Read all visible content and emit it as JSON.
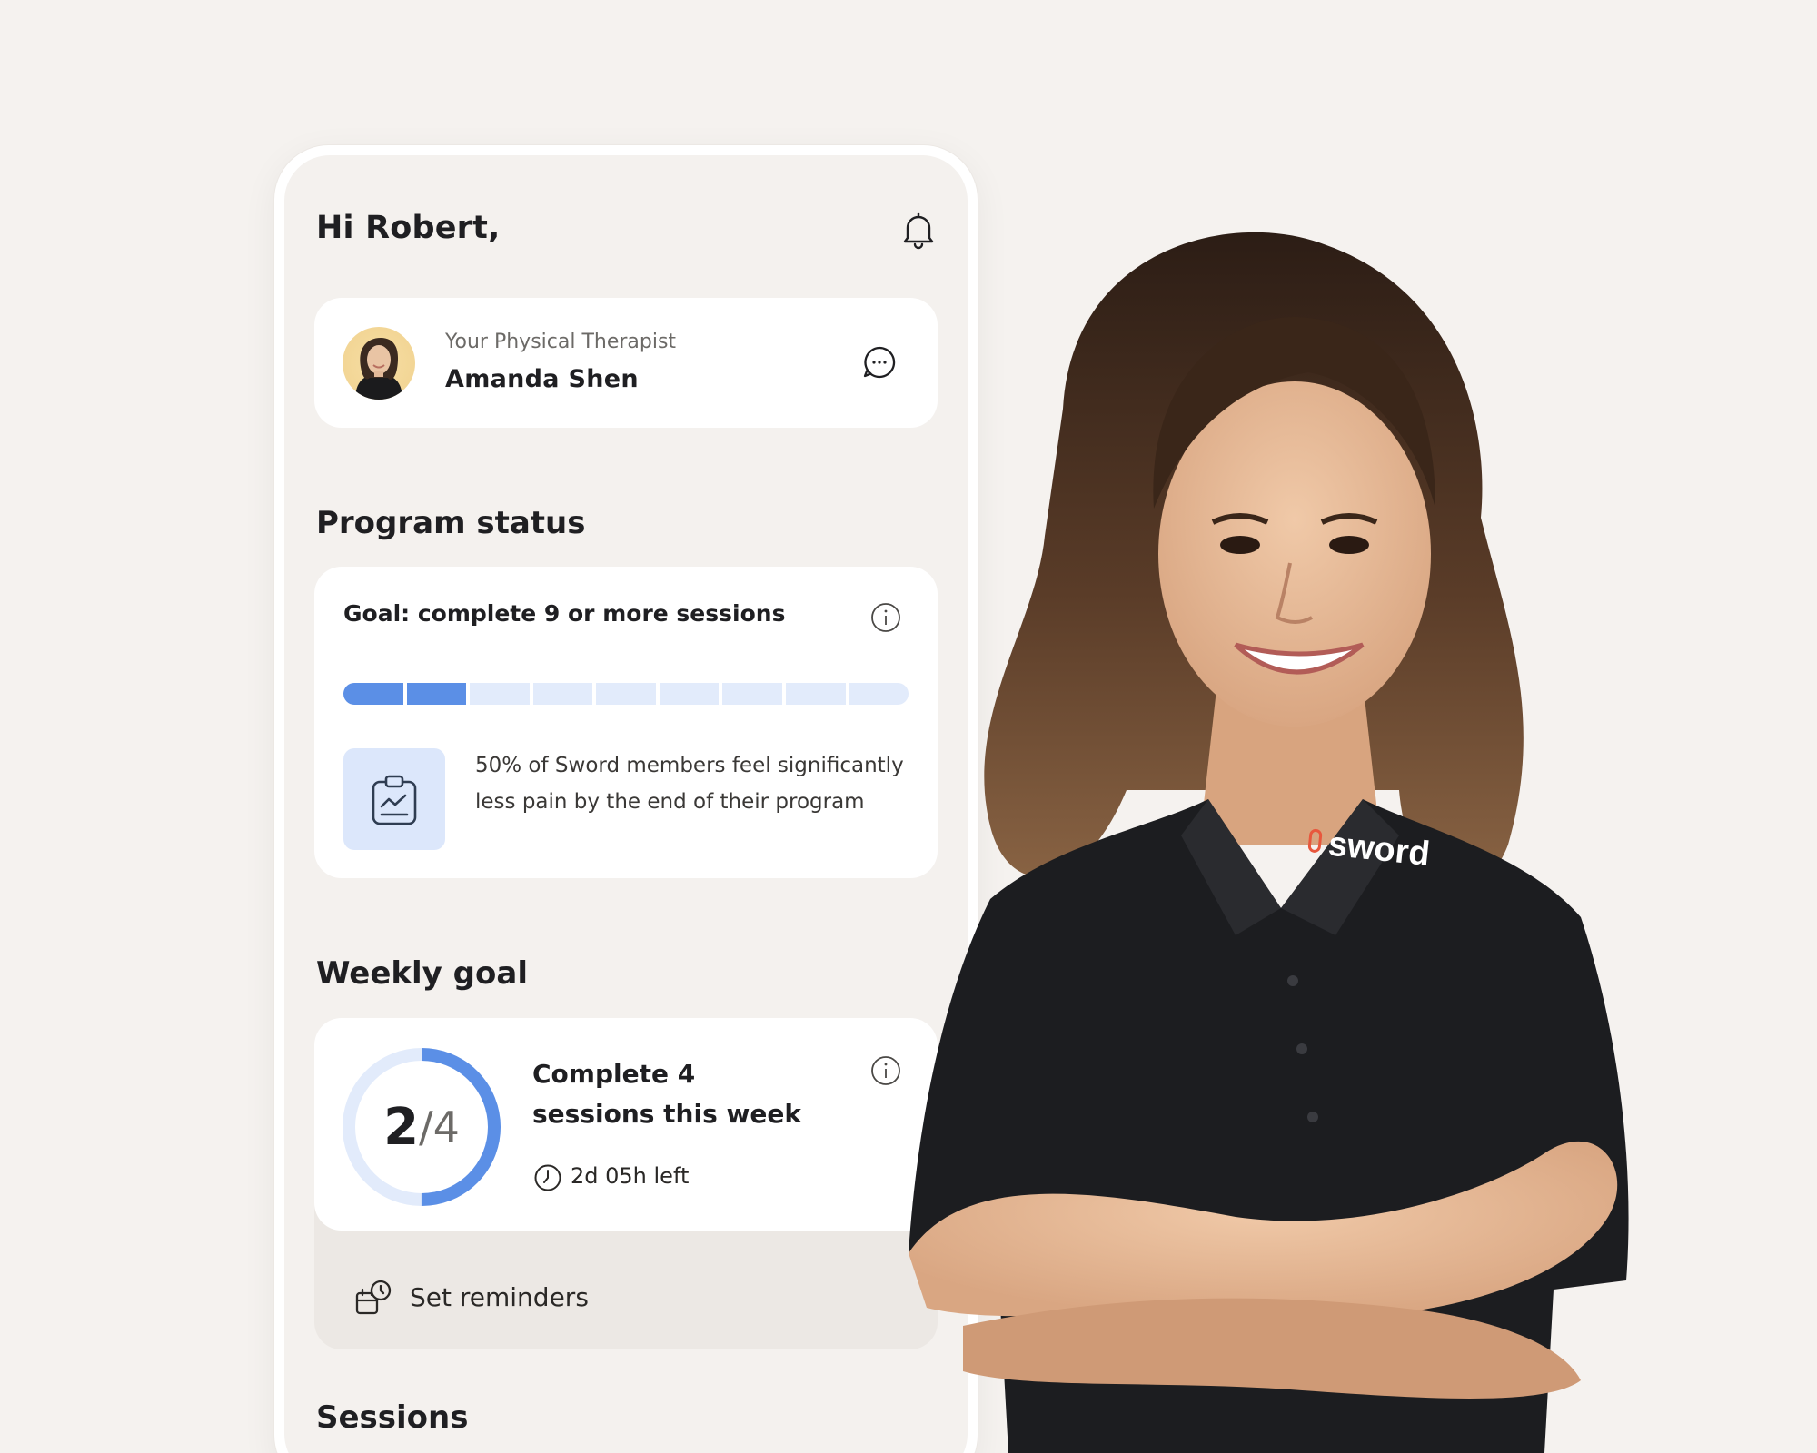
{
  "header": {
    "greeting": "Hi Robert,"
  },
  "therapist": {
    "label": "Your Physical Therapist",
    "name": "Amanda Shen"
  },
  "program_status": {
    "title": "Program status",
    "goal": "Goal: complete 9 or more sessions",
    "progress": {
      "completed_segments": 2,
      "total_segments": 9
    },
    "stat": "50% of Sword members feel significantly less pain by the end of their program"
  },
  "weekly_goal": {
    "title": "Weekly goal",
    "completed": "2",
    "denominator": "/4",
    "progress_fraction": 0.5,
    "description": "Complete 4 sessions this week",
    "time_left": "2d 05h left",
    "reminders_label": "Set reminders"
  },
  "sessions": {
    "title": "Sessions"
  },
  "brand": {
    "logo_text": "sword"
  },
  "colors": {
    "background": "#f5f2ef",
    "accent_blue": "#5b8fe6",
    "light_blue": "#e2ebfb",
    "card": "#ffffff",
    "brand_orange": "#e8573d"
  },
  "icons": {
    "bell": "bell-icon",
    "chat": "chat-bubble-icon",
    "info": "info-icon",
    "clipboard": "clipboard-chart-icon",
    "clock": "clock-icon",
    "reminder": "calendar-reminder-icon"
  }
}
